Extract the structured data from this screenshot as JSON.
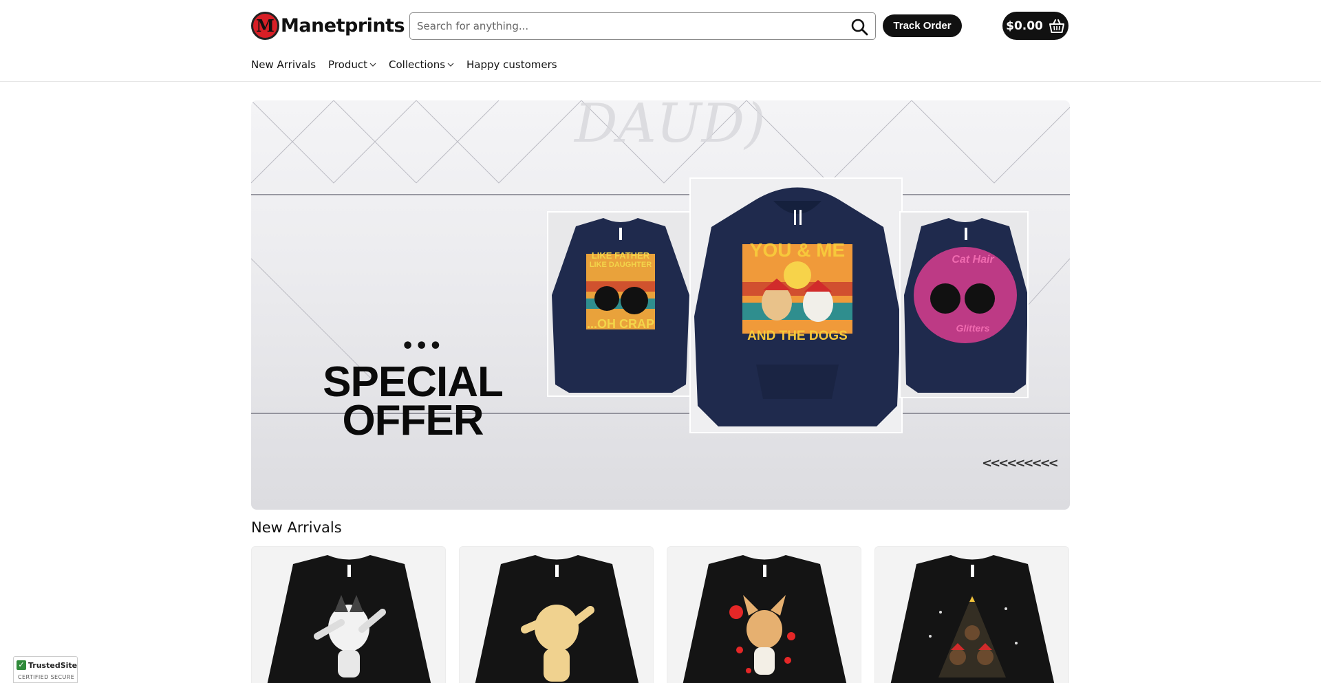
{
  "brand": {
    "logo_letter": "M",
    "name": "Manetprints"
  },
  "search": {
    "placeholder": "Search for anything..."
  },
  "header": {
    "track_order_label": "Track Order",
    "cart_amount": "$0.00"
  },
  "nav": [
    {
      "label": "New Arrivals",
      "has_dropdown": false
    },
    {
      "label": "Product",
      "has_dropdown": true
    },
    {
      "label": "Collections",
      "has_dropdown": true
    },
    {
      "label": "Happy customers",
      "has_dropdown": false
    }
  ],
  "hero": {
    "dots": "•••",
    "title_line1": "SPECIAL",
    "title_line2": "OFFER",
    "arrows": "<<<<<<<<<",
    "products": [
      {
        "design_line1": "LIKE FATHER",
        "design_line2": "LIKE DAUGHTER",
        "design_line3": "...OH CRAP"
      },
      {
        "design_line1": "YOU & ME",
        "design_line2": "AND THE DOGS"
      },
      {
        "design_line1": "Cat Hair",
        "design_line2": "Glitters"
      }
    ]
  },
  "new_arrivals": {
    "title": "New Arrivals",
    "products": [
      {
        "design": "dabbing-husky"
      },
      {
        "design": "dabbing-golden-dog"
      },
      {
        "design": "chihuahua-hearts"
      },
      {
        "design": "christmas-tree-dogs"
      }
    ]
  },
  "trusted_badge": {
    "name": "TrustedSite",
    "subtitle": "CERTIFIED SECURE"
  },
  "colors": {
    "accent_dark": "#111111",
    "logo_red": "#d81f26",
    "sweatshirt_navy": "#1f2a4d",
    "sweatshirt_black": "#141414"
  }
}
